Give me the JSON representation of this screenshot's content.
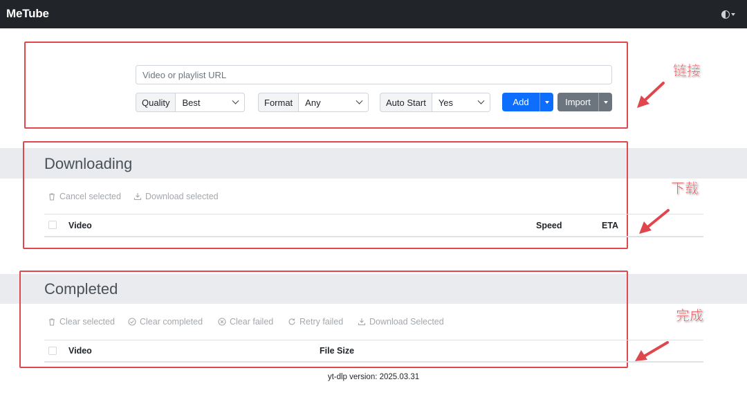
{
  "app": {
    "title": "MeTube"
  },
  "navbar": {
    "theme_icon": "contrast-icon"
  },
  "add_form": {
    "url_placeholder": "Video or playlist URL",
    "quality": {
      "label": "Quality",
      "value": "Best"
    },
    "format": {
      "label": "Format",
      "value": "Any"
    },
    "auto_start": {
      "label": "Auto Start",
      "value": "Yes"
    },
    "add_label": "Add",
    "import_label": "Import"
  },
  "downloading": {
    "title": "Downloading",
    "actions": [
      {
        "label": "Cancel selected",
        "icon": "trash-icon"
      },
      {
        "label": "Download selected",
        "icon": "download-icon"
      }
    ],
    "columns": {
      "video": "Video",
      "speed": "Speed",
      "eta": "ETA"
    }
  },
  "completed": {
    "title": "Completed",
    "actions": [
      {
        "label": "Clear selected",
        "icon": "trash-icon"
      },
      {
        "label": "Clear completed",
        "icon": "check-circle-icon"
      },
      {
        "label": "Clear failed",
        "icon": "x-circle-icon"
      },
      {
        "label": "Retry failed",
        "icon": "refresh-icon"
      },
      {
        "label": "Download Selected",
        "icon": "download-icon"
      }
    ],
    "columns": {
      "video": "Video",
      "file_size": "File Size"
    }
  },
  "footer": {
    "version_text": "yt-dlp version: 2025.03.31"
  },
  "annotations": {
    "link": "链接",
    "download": "下载",
    "complete": "完成"
  },
  "colors": {
    "navbar": "#212529",
    "primary": "#0d6efd",
    "secondary": "#6c757d",
    "annotation_red": "#e0474c"
  }
}
